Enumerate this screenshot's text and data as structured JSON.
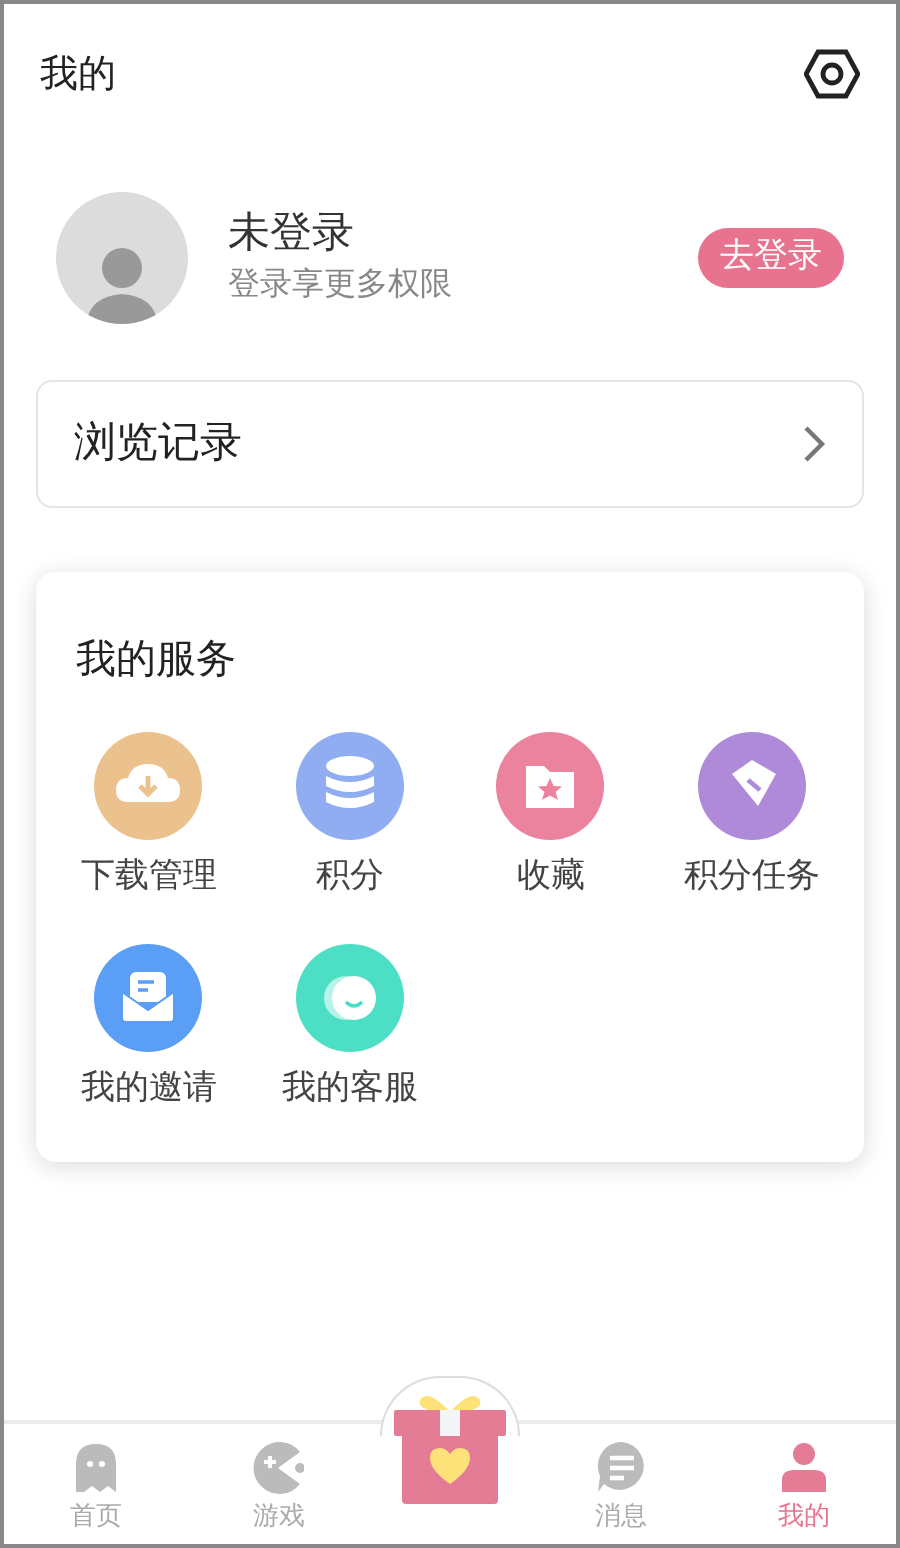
{
  "header": {
    "title": "我的"
  },
  "profile": {
    "name": "未登录",
    "subtitle": "登录享更多权限",
    "login_button": "去登录"
  },
  "history": {
    "label": "浏览记录"
  },
  "services": {
    "title": "我的服务",
    "items": [
      {
        "label": "下载管理",
        "color": "#ebc28d"
      },
      {
        "label": "积分",
        "color": "#8fadf0"
      },
      {
        "label": "收藏",
        "color": "#ec839e"
      },
      {
        "label": "积分任务",
        "color": "#af8ad8"
      },
      {
        "label": "我的邀请",
        "color": "#5a9ef5"
      },
      {
        "label": "我的客服",
        "color": "#4ddfc6"
      }
    ]
  },
  "bottom_nav": [
    {
      "kind": "tab",
      "label": "首页",
      "selected": false
    },
    {
      "kind": "tab",
      "label": "游戏",
      "selected": false
    },
    {
      "kind": "gift"
    },
    {
      "kind": "tab",
      "label": "消息",
      "selected": false
    },
    {
      "kind": "tab",
      "label": "我的",
      "selected": true
    }
  ]
}
